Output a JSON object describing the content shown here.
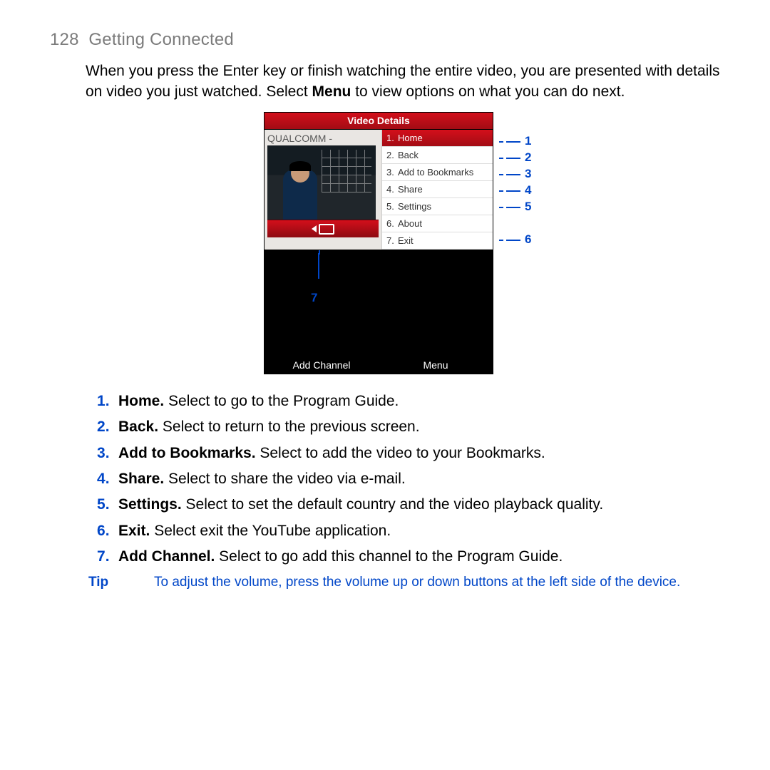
{
  "header": {
    "page_no": "128",
    "section": "Getting Connected"
  },
  "intro": {
    "pre": "When you press the Enter key or finish watching the entire video, you are presented with details on video you just watched. Select ",
    "bold": "Menu",
    "post": " to view options on what you can do next."
  },
  "screenshot": {
    "title": "Video Details",
    "video_title": "QUALCOMM - Convergence",
    "menu": [
      {
        "n": "1.",
        "label": "Home"
      },
      {
        "n": "2.",
        "label": "Back"
      },
      {
        "n": "3.",
        "label": "Add to Bookmarks"
      },
      {
        "n": "4.",
        "label": "Share"
      },
      {
        "n": "5.",
        "label": "Settings"
      },
      {
        "n": "6.",
        "label": "About"
      },
      {
        "n": "7.",
        "label": "Exit"
      }
    ],
    "soft_left": "Add Channel",
    "soft_right": "Menu"
  },
  "callouts": {
    "c1": "1",
    "c2": "2",
    "c3": "3",
    "c4": "4",
    "c5": "5",
    "c6": "6",
    "c7": "7"
  },
  "defs": [
    {
      "term": "Home.",
      "desc": " Select to go to the Program Guide."
    },
    {
      "term": "Back.",
      "desc": " Select to return to the previous screen."
    },
    {
      "term": "Add to Bookmarks.",
      "desc": " Select to add the video to your Bookmarks."
    },
    {
      "term": "Share.",
      "desc": " Select to share the video via e-mail."
    },
    {
      "term": "Settings.",
      "desc": " Select to set the default country and the video playback quality."
    },
    {
      "term": "Exit.",
      "desc": " Select exit the YouTube application."
    },
    {
      "term": "Add Channel.",
      "desc": " Select to go add this channel to the Program Guide."
    }
  ],
  "tip": {
    "label": "Tip",
    "text": "To adjust the volume, press the volume up or down buttons at the left side of the device."
  }
}
